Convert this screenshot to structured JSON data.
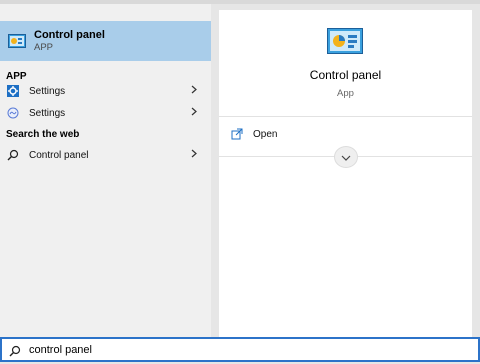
{
  "best_match": {
    "title": "Control panel",
    "subtitle": "APP",
    "icon": "control-panel-icon"
  },
  "sections": {
    "app_header": "APP",
    "web_header": "Search the web"
  },
  "results": [
    {
      "label": "Settings",
      "icon": "settings-gear-icon"
    },
    {
      "label": "Settings",
      "icon": "settings-circle-icon"
    }
  ],
  "web_results": [
    {
      "label": "Control panel",
      "icon": "search-icon"
    }
  ],
  "preview": {
    "title": "Control panel",
    "subtitle": "App",
    "actions": [
      {
        "label": "Open",
        "icon": "open-icon"
      }
    ]
  },
  "search": {
    "value": "control panel"
  },
  "colors": {
    "selection": "#a9cdea",
    "accent": "#2c73c9"
  }
}
